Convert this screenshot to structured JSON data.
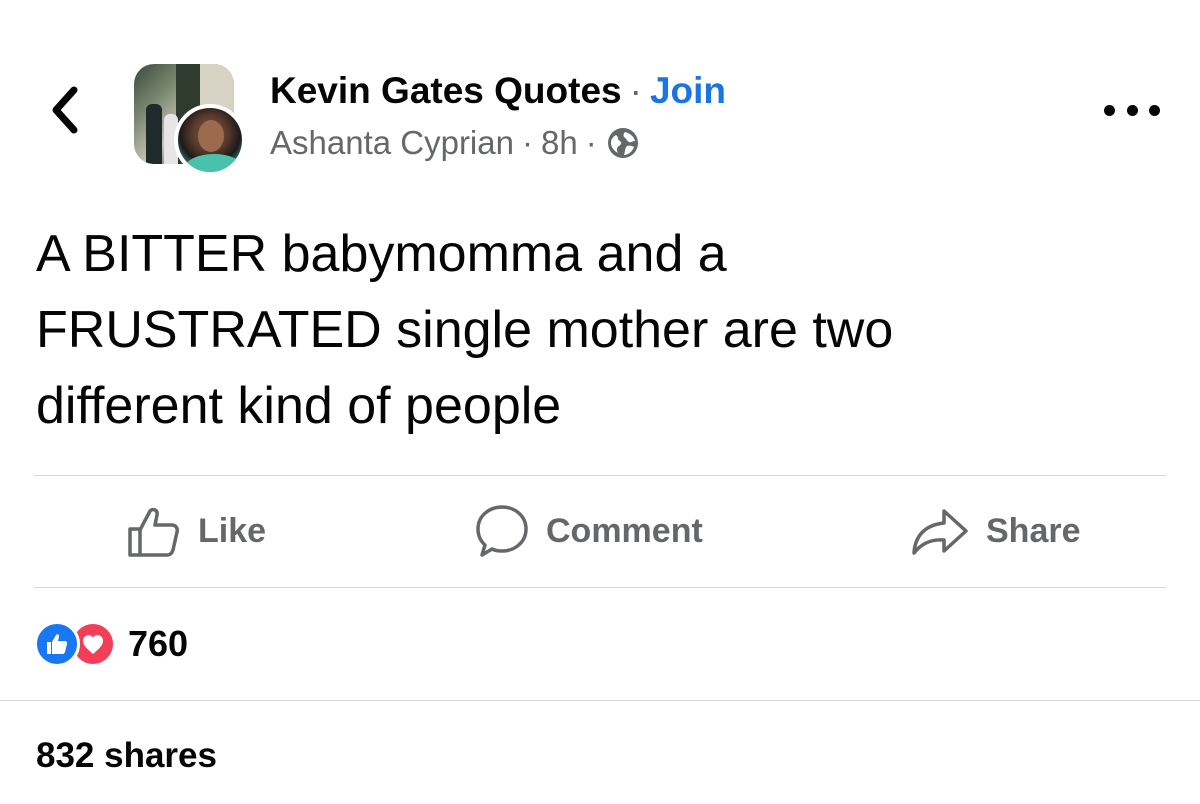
{
  "header": {
    "group_name": "Kevin Gates Quotes",
    "separator": "·",
    "join_label": "Join",
    "author": "Ashanta Cyprian",
    "time": "8h",
    "privacy_icon": "globe-icon"
  },
  "post": {
    "lines": [
      "A BITTER babymomma and a",
      "FRUSTRATED single mother are two",
      "different kind of people"
    ]
  },
  "actions": {
    "like_label": "Like",
    "comment_label": "Comment",
    "share_label": "Share"
  },
  "stats": {
    "reaction_icons": [
      "like-reaction-icon",
      "love-reaction-icon"
    ],
    "reaction_count": "760",
    "shares_text": "832 shares"
  },
  "colors": {
    "link_blue": "#1b74e4",
    "secondary_text": "#65676b",
    "like_blue": "#1877f2",
    "love_red": "#f33e58"
  }
}
